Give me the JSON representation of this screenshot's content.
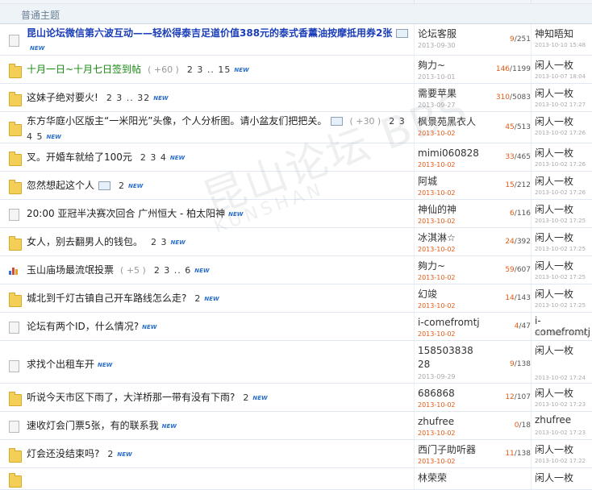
{
  "section_title": "普通主题",
  "watermark": "昆山论坛 KUNSHAN BBS",
  "threads": [
    {
      "icon": "doc",
      "style": "hl-blue",
      "title": "昆山论坛微信第六波互动——轻松得泰吉足道价值388元的泰式香薰油按摩抵用券2张",
      "img": true,
      "new": true,
      "author": "论坛客服",
      "date": "2013-09-30",
      "date_red": false,
      "replies": "9",
      "views": "251",
      "last": "神知晤知",
      "last_time": "2013-10-10 15:48"
    },
    {
      "icon": "folder",
      "style": "hl-green",
      "title": "十月一日~十月七日签到帖",
      "extra": "( +60 )",
      "pages": "2 3 .. 15",
      "new": true,
      "author": "夠力~",
      "date": "2013-10-01",
      "date_red": false,
      "replies": "146",
      "views": "1199",
      "last": "闲人一枚",
      "last_time": "2013-10-07 18:04"
    },
    {
      "icon": "folder",
      "style": "",
      "title": "这妹子绝对要火!",
      "pages": "2 3 .. 32",
      "new": true,
      "author": "需要苹果",
      "date": "2013-09-27",
      "date_red": false,
      "replies": "310",
      "views": "5083",
      "last": "闲人一枚",
      "last_time": "2013-10-02 17:27"
    },
    {
      "icon": "folder",
      "style": "",
      "title": "东方华庭小区版主“一米阳光”头像，个人分析图。请小盆友们把把关。",
      "img": true,
      "extra": "( +30 )",
      "pages": "2 3 4 5",
      "new": true,
      "author": "枫景苑黑衣人",
      "date": "2013-10-02",
      "date_red": true,
      "replies": "45",
      "views": "513",
      "last": "闲人一枚",
      "last_time": "2013-10-02 17:26"
    },
    {
      "icon": "folder",
      "style": "",
      "title": "叉。开婚车就给了100元",
      "pages": "2 3 4",
      "new": true,
      "author": "mimi060828",
      "date": "2013-10-02",
      "date_red": true,
      "replies": "33",
      "views": "465",
      "last": "闲人一枚",
      "last_time": "2013-10-02 17:26"
    },
    {
      "icon": "folder",
      "style": "",
      "title": "忽然想起这个人",
      "img": true,
      "pages": "2",
      "new": true,
      "author": "阿城",
      "date": "2013-10-02",
      "date_red": true,
      "replies": "15",
      "views": "212",
      "last": "闲人一枚",
      "last_time": "2013-10-02 17:26"
    },
    {
      "icon": "doc",
      "style": "",
      "title": "20:00 亚冠半决赛次回合 广州恒大 - 柏太阳神",
      "new": true,
      "author": "神仙的神",
      "date": "2013-10-02",
      "date_red": true,
      "replies": "6",
      "views": "116",
      "last": "闲人一枚",
      "last_time": "2013-10-02 17:25"
    },
    {
      "icon": "folder",
      "style": "",
      "title": "女人，别去翻男人的钱包。",
      "pages": "2 3",
      "new": true,
      "author": "冰淇淋☆",
      "date": "2013-10-02",
      "date_red": true,
      "replies": "24",
      "views": "392",
      "last": "闲人一枚",
      "last_time": "2013-10-02 17:25"
    },
    {
      "icon": "poll",
      "style": "",
      "title": "玉山庙场最流氓投票",
      "extra": "( +5 )",
      "pages": "2 3 .. 6",
      "new": true,
      "author": "夠力~",
      "date": "2013-10-02",
      "date_red": true,
      "replies": "59",
      "views": "607",
      "last": "闲人一枚",
      "last_time": "2013-10-02 17:25"
    },
    {
      "icon": "folder",
      "style": "",
      "title": "城北到千灯古镇自己开车路线怎么走?",
      "pages": "2",
      "new": true,
      "author": "幻竣",
      "date": "2013-10-02",
      "date_red": true,
      "replies": "14",
      "views": "143",
      "last": "闲人一枚",
      "last_time": "2013-10-02 17:25"
    },
    {
      "icon": "doc",
      "style": "",
      "title": "论坛有两个ID，什么情况?",
      "new": true,
      "author": "i-comefromtj",
      "date": "2013-10-02",
      "date_red": true,
      "replies": "4",
      "views": "47",
      "last": "i-comefromtj",
      "last_time": "2013-10-02 17:24"
    },
    {
      "icon": "doc",
      "style": "",
      "title": "求找个出租车开",
      "new": true,
      "author": "15850383828",
      "date": "2013-09-29",
      "date_red": false,
      "replies": "9",
      "views": "138",
      "last": "闲人一枚",
      "last_time": "2013-10-02 17:24"
    },
    {
      "icon": "folder",
      "style": "",
      "title": "听说今天市区下雨了，大洋桥那一带有没有下雨?",
      "pages": "2",
      "new": true,
      "author": "686868",
      "date": "2013-10-02",
      "date_red": true,
      "replies": "12",
      "views": "107",
      "last": "闲人一枚",
      "last_time": "2013-10-02 17:23"
    },
    {
      "icon": "doc",
      "style": "",
      "title": "速收灯会门票5张，有的联系我",
      "new": true,
      "author": "zhufree",
      "date": "2013-10-02",
      "date_red": true,
      "replies": "0",
      "views": "18",
      "last": "zhufree",
      "last_time": "2013-10-02 17:23"
    },
    {
      "icon": "folder",
      "style": "",
      "title": "灯会还没结束吗?",
      "pages": "2",
      "new": true,
      "author": "西门子助听器",
      "date": "2013-10-02",
      "date_red": true,
      "replies": "11",
      "views": "138",
      "last": "闲人一枚",
      "last_time": "2013-10-02 17:22"
    },
    {
      "icon": "folder",
      "style": "",
      "title": "",
      "author": "林荣荣",
      "date": "",
      "date_red": true,
      "replies": "",
      "views": "",
      "last": "闲人一枚",
      "last_time": ""
    }
  ],
  "new_badge": "NEW"
}
